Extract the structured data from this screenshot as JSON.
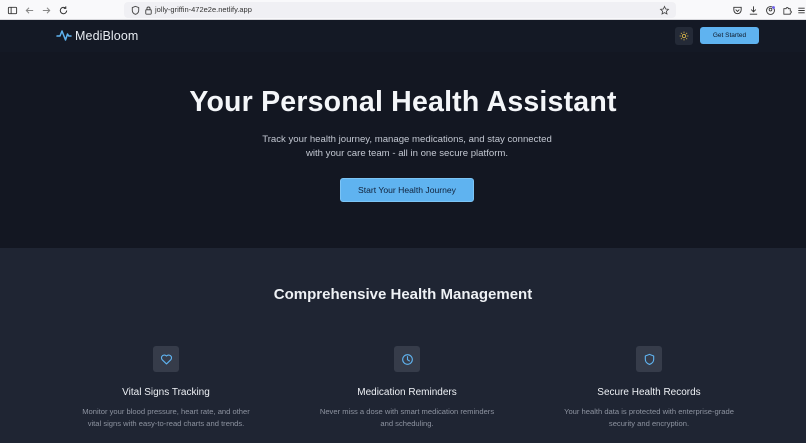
{
  "browser": {
    "url": "jolly-griffin-472e2e.netlify.app",
    "icons": [
      "sidebar-icon",
      "back-icon",
      "forward-icon",
      "reload-icon",
      "shield-icon",
      "lock-icon",
      "bookmark-star-icon",
      "pocket-icon",
      "download-icon",
      "account-icon",
      "extensions-icon",
      "menu-icon"
    ]
  },
  "nav": {
    "brand": "MediBloom",
    "brand_icon": "pulse-icon",
    "theme_icon": "sun-icon",
    "cta": "Get Started"
  },
  "hero": {
    "title": "Your Personal Health Assistant",
    "subtitle_line1": "Track your health journey, manage medications, and stay connected",
    "subtitle_line2": "with your care team - all in one secure platform.",
    "cta": "Start Your Health Journey"
  },
  "features": {
    "title": "Comprehensive Health Management",
    "items": [
      {
        "icon": "heart-icon",
        "title": "Vital Signs Tracking",
        "desc_line1": "Monitor your blood pressure, heart rate, and other",
        "desc_line2": "vital signs with easy-to-read charts and trends."
      },
      {
        "icon": "clock-icon",
        "title": "Medication Reminders",
        "desc_line1": "Never miss a dose with smart medication reminders",
        "desc_line2": "and scheduling."
      },
      {
        "icon": "shield-icon",
        "title": "Secure Health Records",
        "desc_line1": "Your health data is protected with enterprise-grade",
        "desc_line2": "security and encryption."
      }
    ]
  },
  "colors": {
    "accent": "#5fb3f0",
    "hero_bg": "#131722",
    "features_bg": "#1f2533"
  }
}
